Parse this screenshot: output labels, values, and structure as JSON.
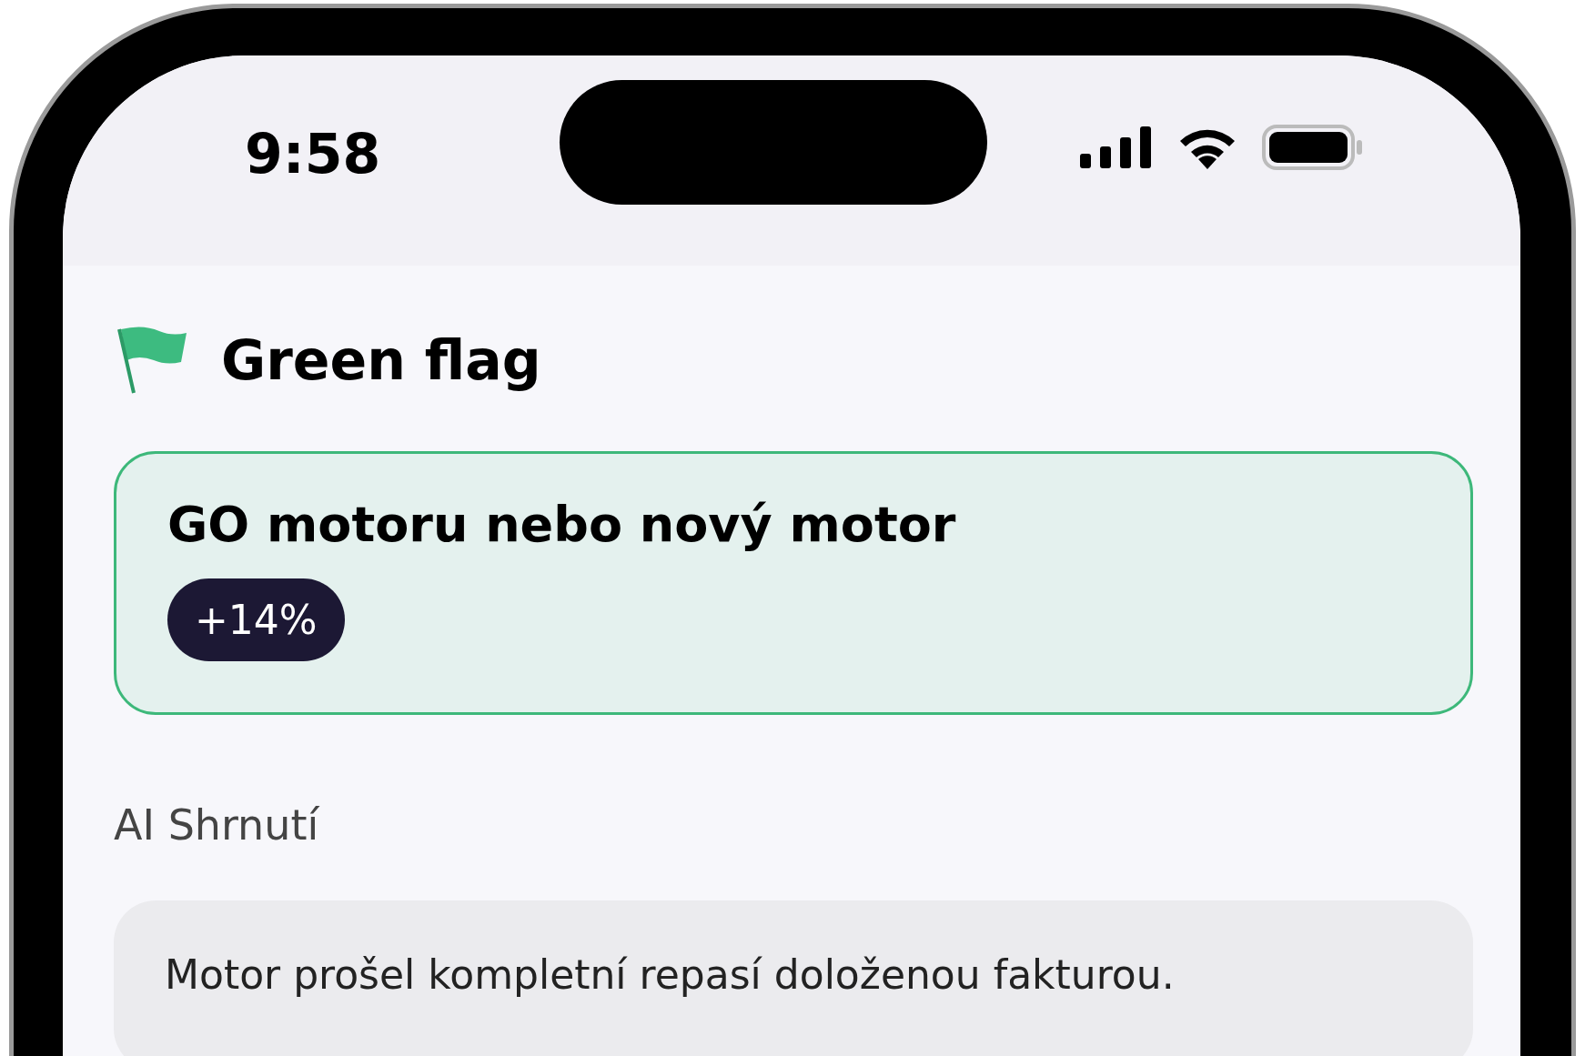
{
  "status_bar": {
    "time": "9:58"
  },
  "header": {
    "title": "Green flag"
  },
  "highlight_card": {
    "title": "GO motoru nebo nový motor",
    "badge": "+14%"
  },
  "section_label": "AI Shrnutí",
  "summary": {
    "text": "Motor prošel kompletní repasí doloženou fakturou."
  }
}
